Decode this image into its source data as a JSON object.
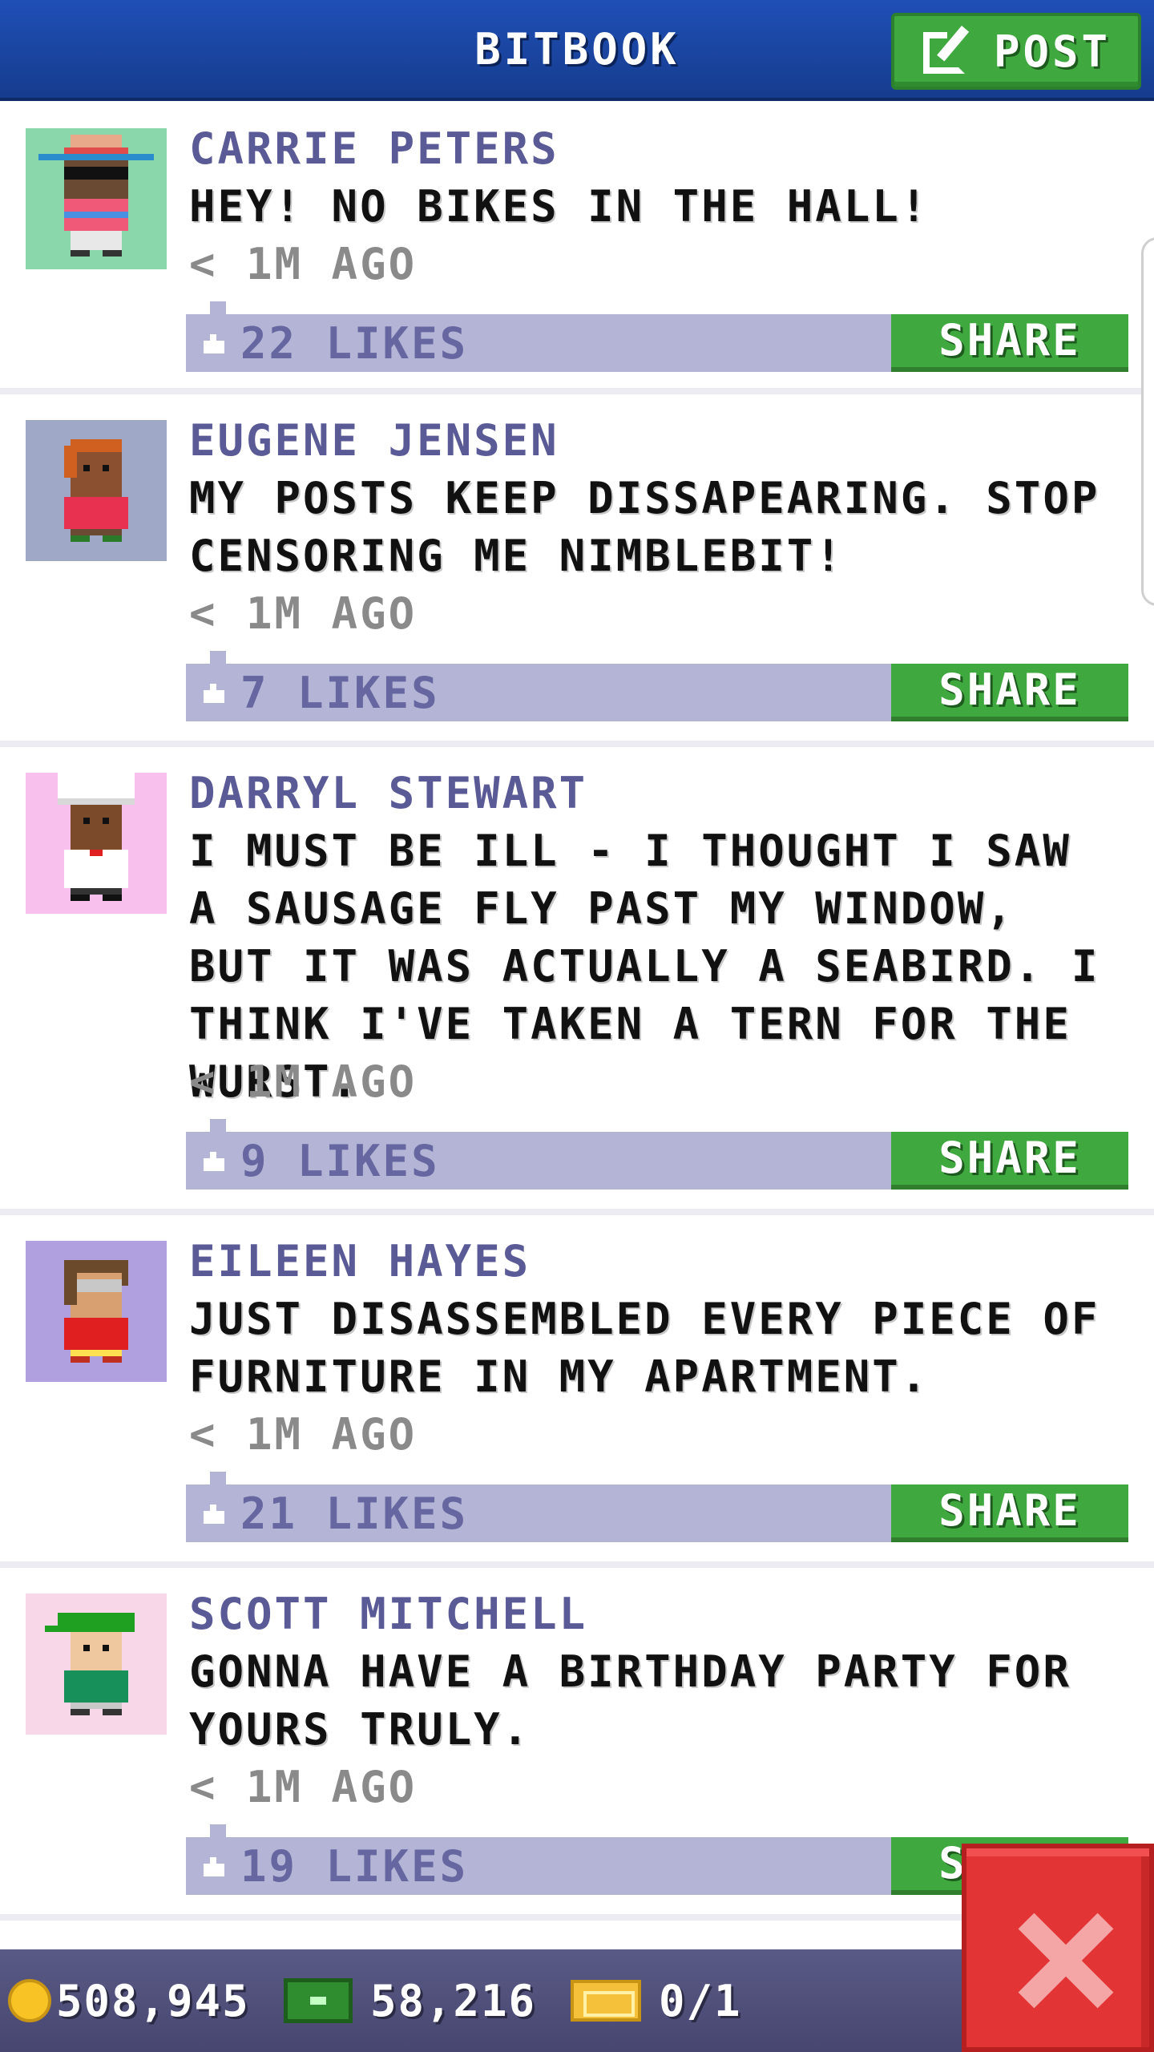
{
  "header": {
    "title": "BITBOOK",
    "post_label": "POST"
  },
  "posts": [
    {
      "author": "CARRIE PETERS",
      "text": "HEY! NO BIKES IN THE HALL!",
      "time": "< 1M AGO",
      "likes": "22 LIKES",
      "share_label": "SHARE"
    },
    {
      "author": "EUGENE JENSEN",
      "text": "MY POSTS KEEP DISSAPEARING. STOP CENSORING ME NIMBLEBIT!",
      "time": "< 1M AGO",
      "likes": "7 LIKES",
      "share_label": "SHARE"
    },
    {
      "author": "DARRYL STEWART",
      "text": "I MUST BE ILL - I THOUGHT I SAW A SAUSAGE FLY PAST MY WINDOW, BUT IT WAS ACTUALLY A SEABIRD. I THINK I'VE TAKEN A TERN FOR THE WURST.",
      "time": "< 1M AGO",
      "likes": "9 LIKES",
      "share_label": "SHARE"
    },
    {
      "author": "EILEEN HAYES",
      "text": "JUST DISASSEMBLED EVERY PIECE OF FURNITURE IN MY APARTMENT.",
      "time": "< 1M AGO",
      "likes": "21 LIKES",
      "share_label": "SHARE"
    },
    {
      "author": "SCOTT MITCHELL",
      "text": "GONNA HAVE A BIRTHDAY PARTY FOR YOURS TRULY.",
      "time": "< 1M AGO",
      "likes": "19 LIKES",
      "share_label": "SHARE"
    }
  ],
  "status_bar": {
    "coins": "508,945",
    "bux": "58,216",
    "tickets": "0/1"
  },
  "colors": {
    "header": "#1f4fb6",
    "accent_green": "#3fa83f",
    "likes_bar": "#b4b4d6",
    "close_red": "#e23434"
  },
  "icons": {
    "post": "edit-icon",
    "like": "thumbs-up-icon",
    "coin": "coin-icon",
    "bux": "bux-icon",
    "ticket": "ticket-icon",
    "close": "close-icon"
  }
}
